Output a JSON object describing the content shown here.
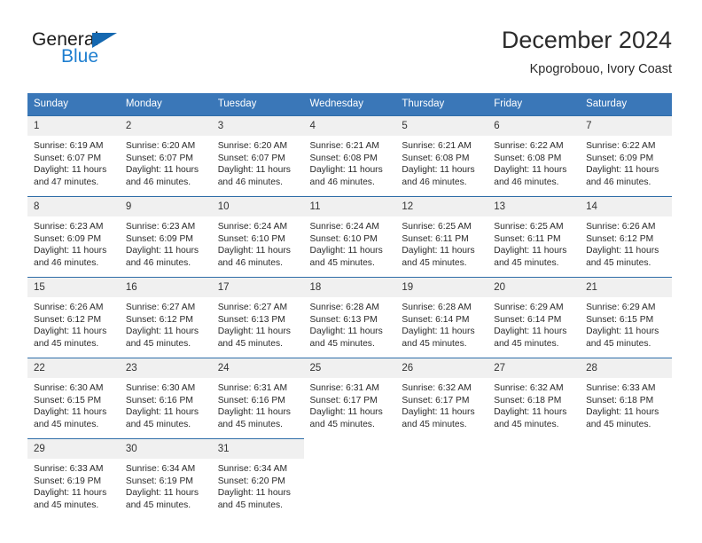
{
  "brand": {
    "name_part1": "General",
    "name_part2": "Blue",
    "triangle_color": "#1568b0",
    "blue_color": "#1f7fd0"
  },
  "header": {
    "title": "December 2024",
    "subtitle": "Kpogrobouo, Ivory Coast"
  },
  "theme": {
    "header_blue": "#3a77b8",
    "row_border_blue": "#2f6da8",
    "daynum_bg": "#f0f0f0"
  },
  "weekdays": [
    "Sunday",
    "Monday",
    "Tuesday",
    "Wednesday",
    "Thursday",
    "Friday",
    "Saturday"
  ],
  "weeks": [
    [
      {
        "day": "1",
        "sunrise": "Sunrise: 6:19 AM",
        "sunset": "Sunset: 6:07 PM",
        "daylight": "Daylight: 11 hours and 47 minutes."
      },
      {
        "day": "2",
        "sunrise": "Sunrise: 6:20 AM",
        "sunset": "Sunset: 6:07 PM",
        "daylight": "Daylight: 11 hours and 46 minutes."
      },
      {
        "day": "3",
        "sunrise": "Sunrise: 6:20 AM",
        "sunset": "Sunset: 6:07 PM",
        "daylight": "Daylight: 11 hours and 46 minutes."
      },
      {
        "day": "4",
        "sunrise": "Sunrise: 6:21 AM",
        "sunset": "Sunset: 6:08 PM",
        "daylight": "Daylight: 11 hours and 46 minutes."
      },
      {
        "day": "5",
        "sunrise": "Sunrise: 6:21 AM",
        "sunset": "Sunset: 6:08 PM",
        "daylight": "Daylight: 11 hours and 46 minutes."
      },
      {
        "day": "6",
        "sunrise": "Sunrise: 6:22 AM",
        "sunset": "Sunset: 6:08 PM",
        "daylight": "Daylight: 11 hours and 46 minutes."
      },
      {
        "day": "7",
        "sunrise": "Sunrise: 6:22 AM",
        "sunset": "Sunset: 6:09 PM",
        "daylight": "Daylight: 11 hours and 46 minutes."
      }
    ],
    [
      {
        "day": "8",
        "sunrise": "Sunrise: 6:23 AM",
        "sunset": "Sunset: 6:09 PM",
        "daylight": "Daylight: 11 hours and 46 minutes."
      },
      {
        "day": "9",
        "sunrise": "Sunrise: 6:23 AM",
        "sunset": "Sunset: 6:09 PM",
        "daylight": "Daylight: 11 hours and 46 minutes."
      },
      {
        "day": "10",
        "sunrise": "Sunrise: 6:24 AM",
        "sunset": "Sunset: 6:10 PM",
        "daylight": "Daylight: 11 hours and 46 minutes."
      },
      {
        "day": "11",
        "sunrise": "Sunrise: 6:24 AM",
        "sunset": "Sunset: 6:10 PM",
        "daylight": "Daylight: 11 hours and 45 minutes."
      },
      {
        "day": "12",
        "sunrise": "Sunrise: 6:25 AM",
        "sunset": "Sunset: 6:11 PM",
        "daylight": "Daylight: 11 hours and 45 minutes."
      },
      {
        "day": "13",
        "sunrise": "Sunrise: 6:25 AM",
        "sunset": "Sunset: 6:11 PM",
        "daylight": "Daylight: 11 hours and 45 minutes."
      },
      {
        "day": "14",
        "sunrise": "Sunrise: 6:26 AM",
        "sunset": "Sunset: 6:12 PM",
        "daylight": "Daylight: 11 hours and 45 minutes."
      }
    ],
    [
      {
        "day": "15",
        "sunrise": "Sunrise: 6:26 AM",
        "sunset": "Sunset: 6:12 PM",
        "daylight": "Daylight: 11 hours and 45 minutes."
      },
      {
        "day": "16",
        "sunrise": "Sunrise: 6:27 AM",
        "sunset": "Sunset: 6:12 PM",
        "daylight": "Daylight: 11 hours and 45 minutes."
      },
      {
        "day": "17",
        "sunrise": "Sunrise: 6:27 AM",
        "sunset": "Sunset: 6:13 PM",
        "daylight": "Daylight: 11 hours and 45 minutes."
      },
      {
        "day": "18",
        "sunrise": "Sunrise: 6:28 AM",
        "sunset": "Sunset: 6:13 PM",
        "daylight": "Daylight: 11 hours and 45 minutes."
      },
      {
        "day": "19",
        "sunrise": "Sunrise: 6:28 AM",
        "sunset": "Sunset: 6:14 PM",
        "daylight": "Daylight: 11 hours and 45 minutes."
      },
      {
        "day": "20",
        "sunrise": "Sunrise: 6:29 AM",
        "sunset": "Sunset: 6:14 PM",
        "daylight": "Daylight: 11 hours and 45 minutes."
      },
      {
        "day": "21",
        "sunrise": "Sunrise: 6:29 AM",
        "sunset": "Sunset: 6:15 PM",
        "daylight": "Daylight: 11 hours and 45 minutes."
      }
    ],
    [
      {
        "day": "22",
        "sunrise": "Sunrise: 6:30 AM",
        "sunset": "Sunset: 6:15 PM",
        "daylight": "Daylight: 11 hours and 45 minutes."
      },
      {
        "day": "23",
        "sunrise": "Sunrise: 6:30 AM",
        "sunset": "Sunset: 6:16 PM",
        "daylight": "Daylight: 11 hours and 45 minutes."
      },
      {
        "day": "24",
        "sunrise": "Sunrise: 6:31 AM",
        "sunset": "Sunset: 6:16 PM",
        "daylight": "Daylight: 11 hours and 45 minutes."
      },
      {
        "day": "25",
        "sunrise": "Sunrise: 6:31 AM",
        "sunset": "Sunset: 6:17 PM",
        "daylight": "Daylight: 11 hours and 45 minutes."
      },
      {
        "day": "26",
        "sunrise": "Sunrise: 6:32 AM",
        "sunset": "Sunset: 6:17 PM",
        "daylight": "Daylight: 11 hours and 45 minutes."
      },
      {
        "day": "27",
        "sunrise": "Sunrise: 6:32 AM",
        "sunset": "Sunset: 6:18 PM",
        "daylight": "Daylight: 11 hours and 45 minutes."
      },
      {
        "day": "28",
        "sunrise": "Sunrise: 6:33 AM",
        "sunset": "Sunset: 6:18 PM",
        "daylight": "Daylight: 11 hours and 45 minutes."
      }
    ],
    [
      {
        "day": "29",
        "sunrise": "Sunrise: 6:33 AM",
        "sunset": "Sunset: 6:19 PM",
        "daylight": "Daylight: 11 hours and 45 minutes."
      },
      {
        "day": "30",
        "sunrise": "Sunrise: 6:34 AM",
        "sunset": "Sunset: 6:19 PM",
        "daylight": "Daylight: 11 hours and 45 minutes."
      },
      {
        "day": "31",
        "sunrise": "Sunrise: 6:34 AM",
        "sunset": "Sunset: 6:20 PM",
        "daylight": "Daylight: 11 hours and 45 minutes."
      },
      null,
      null,
      null,
      null
    ]
  ]
}
